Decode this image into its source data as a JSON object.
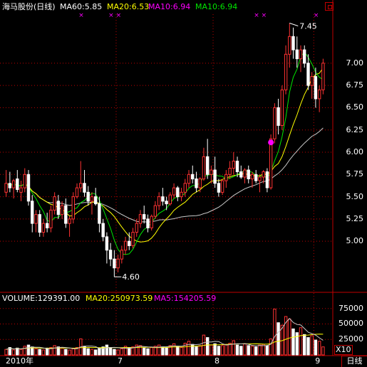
{
  "header": {
    "stock_label": "海马股份(日线)",
    "ma60_label": "MA60:5.85",
    "ma20_label": "MA20:6.53",
    "ma10_label": "MA10:6.94",
    "ma5_label": "MA10:6.94"
  },
  "volume_header": {
    "volume_label": "VOLUME:129391.00",
    "ma20_label": "MA20:250973.59",
    "ma5_label": "MA5:154205.59"
  },
  "colors": {
    "up": "#ff3232",
    "down": "#ffffff",
    "ma5": "#c8c8c8",
    "ma10": "#ffff00",
    "ma20": "#ff00ff",
    "ma60": "#00e600",
    "grid": "#c00000"
  },
  "annotations": {
    "high_label": "7.45",
    "low_label": "4.60"
  },
  "x_labels": [
    "2010年",
    "7",
    "8",
    "9"
  ],
  "tab_daily": "日线",
  "scale_label": "X10",
  "chart_data": [
    {
      "type": "candlestick",
      "title": "海马股份(日线)",
      "y_ticks": [
        5.0,
        5.25,
        5.5,
        5.75,
        6.0,
        6.25,
        6.5,
        6.75,
        7.0
      ],
      "y_tick_labels": [
        "5.00",
        "5.25",
        "5.50",
        "5.75",
        "6.00",
        "6.25",
        "6.50",
        "6.75",
        "7.00"
      ],
      "ylim": [
        4.45,
        7.55
      ],
      "x_tick_labels": [
        "2010年",
        "7",
        "8",
        "9"
      ],
      "x_tick_index": [
        0,
        30,
        56,
        83
      ],
      "grid": true,
      "high": 7.45,
      "low": 4.6,
      "candles": [
        [
          5.55,
          5.8,
          5.5,
          5.65
        ],
        [
          5.65,
          5.78,
          5.55,
          5.6
        ],
        [
          5.6,
          5.7,
          5.48,
          5.68
        ],
        [
          5.7,
          5.8,
          5.55,
          5.58
        ],
        [
          5.55,
          5.68,
          5.45,
          5.6
        ],
        [
          5.6,
          5.82,
          5.55,
          5.75
        ],
        [
          5.75,
          5.8,
          5.4,
          5.45
        ],
        [
          5.45,
          5.52,
          5.1,
          5.2
        ],
        [
          5.2,
          5.35,
          5.1,
          5.3
        ],
        [
          5.3,
          5.35,
          5.05,
          5.1
        ],
        [
          5.1,
          5.25,
          5.05,
          5.2
        ],
        [
          5.2,
          5.32,
          5.1,
          5.15
        ],
        [
          5.15,
          5.4,
          5.1,
          5.35
        ],
        [
          5.35,
          5.55,
          5.3,
          5.5
        ],
        [
          5.45,
          5.52,
          5.25,
          5.3
        ],
        [
          5.3,
          5.45,
          5.25,
          5.4
        ],
        [
          5.4,
          5.48,
          5.15,
          5.2
        ],
        [
          5.2,
          5.28,
          5.05,
          5.25
        ],
        [
          5.25,
          5.55,
          5.2,
          5.5
        ],
        [
          5.5,
          5.65,
          5.48,
          5.6
        ],
        [
          5.6,
          5.9,
          5.55,
          5.65
        ],
        [
          5.65,
          5.8,
          5.5,
          5.55
        ],
        [
          5.55,
          5.62,
          5.4,
          5.45
        ],
        [
          5.45,
          5.55,
          5.3,
          5.5
        ],
        [
          5.5,
          5.6,
          5.4,
          5.42
        ],
        [
          5.42,
          5.5,
          5.1,
          5.2
        ],
        [
          5.2,
          5.25,
          5.0,
          5.05
        ],
        [
          5.05,
          5.1,
          4.75,
          4.9
        ],
        [
          4.9,
          4.98,
          4.72,
          4.8
        ],
        [
          4.8,
          4.9,
          4.6,
          4.7
        ],
        [
          4.7,
          4.85,
          4.65,
          4.8
        ],
        [
          4.8,
          4.95,
          4.75,
          4.9
        ],
        [
          4.9,
          5.05,
          4.85,
          5.0
        ],
        [
          5.0,
          5.1,
          4.9,
          4.95
        ],
        [
          4.95,
          5.15,
          4.92,
          5.1
        ],
        [
          5.1,
          5.25,
          5.05,
          5.2
        ],
        [
          5.2,
          5.35,
          5.15,
          5.3
        ],
        [
          5.3,
          5.4,
          5.2,
          5.25
        ],
        [
          5.25,
          5.3,
          5.1,
          5.15
        ],
        [
          5.15,
          5.3,
          5.12,
          5.28
        ],
        [
          5.28,
          5.45,
          5.25,
          5.4
        ],
        [
          5.4,
          5.55,
          5.35,
          5.5
        ],
        [
          5.5,
          5.6,
          5.4,
          5.45
        ],
        [
          5.45,
          5.5,
          5.35,
          5.42
        ],
        [
          5.42,
          5.55,
          5.4,
          5.52
        ],
        [
          5.52,
          5.65,
          5.48,
          5.6
        ],
        [
          5.6,
          5.62,
          5.45,
          5.5
        ],
        [
          5.5,
          5.6,
          5.45,
          5.55
        ],
        [
          5.55,
          5.7,
          5.5,
          5.65
        ],
        [
          5.65,
          5.8,
          5.6,
          5.75
        ],
        [
          5.75,
          5.85,
          5.65,
          5.7
        ],
        [
          5.7,
          5.78,
          5.55,
          5.6
        ],
        [
          5.6,
          5.72,
          5.55,
          5.7
        ],
        [
          5.7,
          6.05,
          5.68,
          5.95
        ],
        [
          5.95,
          6.15,
          5.7,
          5.75
        ],
        [
          5.75,
          5.85,
          5.65,
          5.8
        ],
        [
          5.8,
          5.95,
          5.6,
          5.65
        ],
        [
          5.65,
          5.7,
          5.5,
          5.55
        ],
        [
          5.55,
          5.7,
          5.52,
          5.68
        ],
        [
          5.68,
          5.8,
          5.6,
          5.75
        ],
        [
          5.75,
          5.9,
          5.7,
          5.82
        ],
        [
          5.82,
          6.0,
          5.75,
          5.9
        ],
        [
          5.9,
          5.95,
          5.72,
          5.78
        ],
        [
          5.78,
          5.85,
          5.7,
          5.72
        ],
        [
          5.72,
          5.82,
          5.65,
          5.8
        ],
        [
          5.8,
          5.85,
          5.65,
          5.7
        ],
        [
          5.7,
          5.78,
          5.6,
          5.75
        ],
        [
          5.75,
          5.8,
          5.65,
          5.68
        ],
        [
          5.68,
          5.75,
          5.55,
          5.72
        ],
        [
          5.72,
          5.8,
          5.65,
          5.78
        ],
        [
          5.78,
          5.82,
          5.55,
          5.6
        ],
        [
          5.6,
          6.2,
          5.58,
          6.15
        ],
        [
          6.15,
          6.55,
          6.1,
          6.5
        ],
        [
          6.5,
          6.6,
          6.2,
          6.3
        ],
        [
          6.3,
          6.75,
          6.25,
          6.7
        ],
        [
          6.7,
          7.2,
          6.65,
          7.1
        ],
        [
          7.1,
          7.45,
          6.95,
          7.3
        ],
        [
          7.3,
          7.4,
          7.05,
          7.15
        ],
        [
          7.15,
          7.3,
          6.95,
          7.05
        ],
        [
          7.05,
          7.2,
          6.9,
          7.15
        ],
        [
          7.15,
          7.2,
          6.95,
          7.0
        ],
        [
          7.0,
          7.1,
          6.7,
          6.75
        ],
        [
          6.75,
          6.9,
          6.6,
          6.85
        ],
        [
          6.85,
          6.95,
          6.5,
          6.6
        ],
        [
          6.6,
          6.75,
          6.45,
          6.7
        ],
        [
          6.7,
          7.05,
          6.65,
          7.0
        ]
      ]
    },
    {
      "type": "bar",
      "title": "VOLUME",
      "y_ticks": [
        25000,
        50000,
        75000
      ],
      "y_tick_labels": [
        "25000",
        "50000",
        "75000"
      ],
      "ylim": [
        0,
        85000
      ],
      "scale_multiplier": "X10",
      "values": [
        9000,
        12000,
        8000,
        11000,
        9000,
        14000,
        16000,
        13000,
        10000,
        9000,
        8000,
        11000,
        12000,
        15000,
        13000,
        11000,
        9000,
        8000,
        10000,
        12000,
        26000,
        14000,
        10000,
        9000,
        8000,
        11000,
        13000,
        16000,
        12000,
        9000,
        8000,
        10000,
        14000,
        12000,
        13000,
        16000,
        15000,
        11000,
        10000,
        12000,
        14000,
        16000,
        13000,
        11000,
        15000,
        18000,
        14000,
        12000,
        19000,
        22000,
        17000,
        13000,
        15000,
        32000,
        28000,
        16000,
        18000,
        14000,
        15000,
        17000,
        19000,
        23000,
        16000,
        14000,
        18000,
        15000,
        14000,
        13000,
        16000,
        17000,
        15000,
        26000,
        74000,
        52000,
        48000,
        62000,
        58000,
        42000,
        36000,
        44000,
        33000,
        28000,
        31000,
        24000,
        22000,
        13000
      ]
    }
  ]
}
